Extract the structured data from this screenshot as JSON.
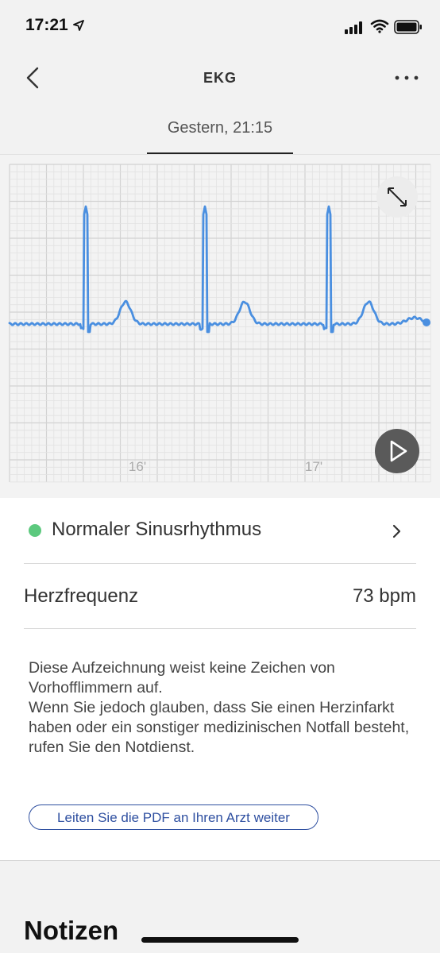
{
  "status_bar": {
    "time": "17:21"
  },
  "nav": {
    "title": "EKG"
  },
  "tab": {
    "label": "Gestern, 21:15"
  },
  "ecg": {
    "time_labels": [
      "16'",
      "17'"
    ],
    "colors": {
      "trace": "#4a8fe0",
      "grid_minor": "#e2e2e2",
      "grid_major": "#d2d2d2"
    }
  },
  "result": {
    "rhythm": "Normaler Sinusrhythmus",
    "heart_rate_label": "Herzfrequenz",
    "heart_rate_value": "73 bpm",
    "description_lines": [
      "Diese Aufzeichnung weist keine Zeichen von Vorhofflimmern auf.",
      "Wenn Sie jedoch glauben, dass Sie einen Herzinfarkt haben oder ein sonstiger medizinischen Notfall besteht, rufen Sie den Notdienst."
    ],
    "pdf_button": "Leiten Sie die PDF an Ihren Arzt weiter"
  },
  "notes": {
    "title": "Notizen"
  }
}
